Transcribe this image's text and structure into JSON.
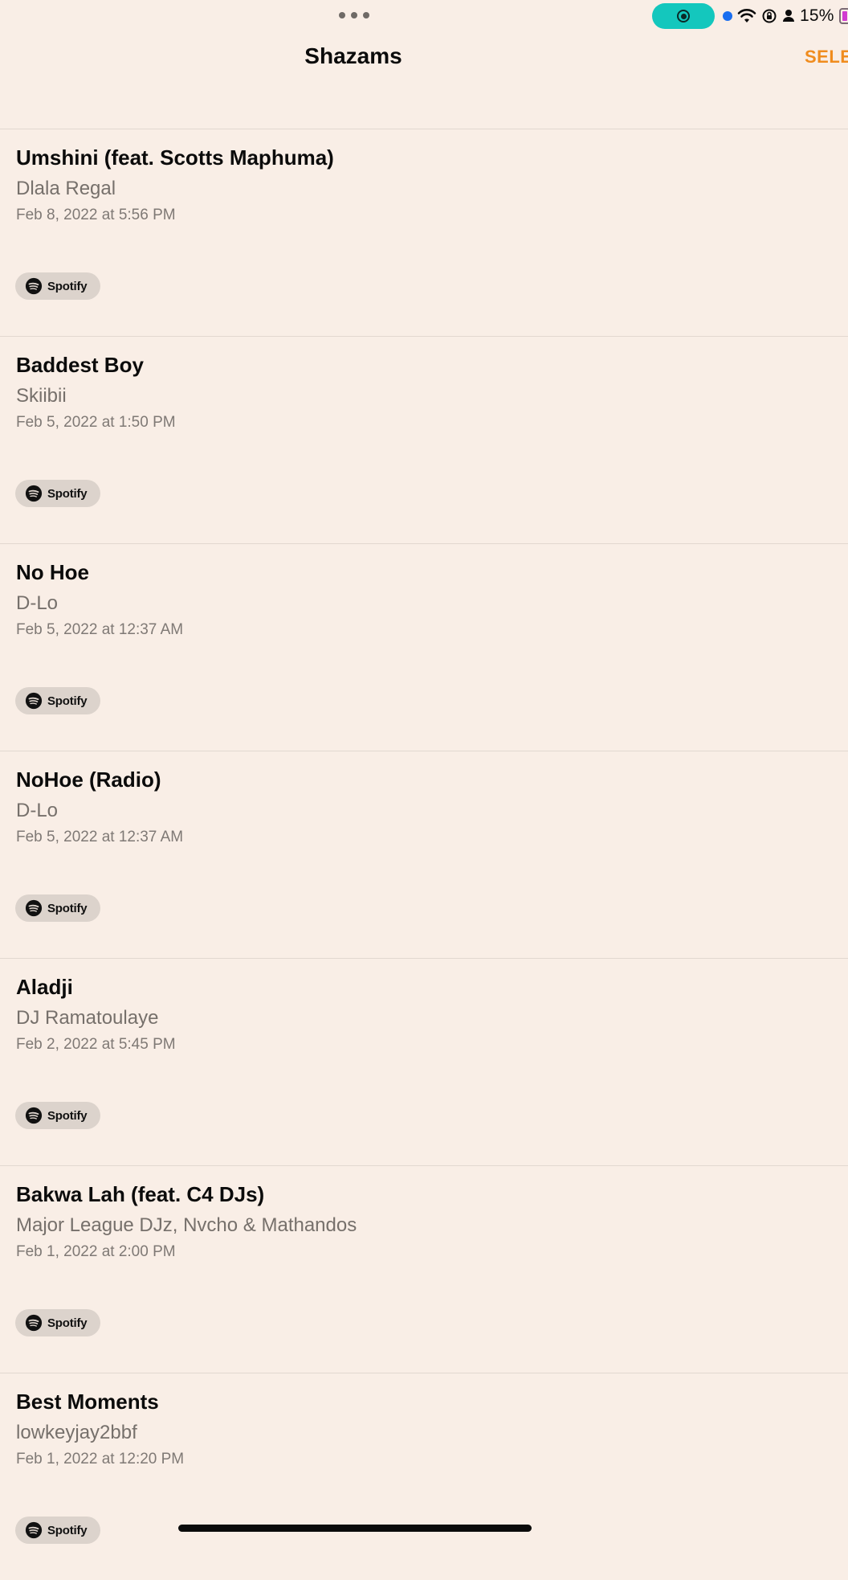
{
  "status_bar": {
    "battery_percent": "15%",
    "battery_level": 0.15,
    "icons": [
      "recording-icon",
      "location-dot-icon",
      "wifi-icon",
      "orientation-lock-icon",
      "person-icon",
      "battery-icon"
    ]
  },
  "nav": {
    "title": "Shazams",
    "select_label": "SELE",
    "accent_color": "#f08c1e"
  },
  "items": [
    {
      "title": "Umshini (feat. Scotts Maphuma)",
      "artist": "Dlala Regal",
      "date": "Feb 8, 2022 at 5:56 PM",
      "service": "Spotify"
    },
    {
      "title": "Baddest Boy",
      "artist": "Skiibii",
      "date": "Feb 5, 2022 at 1:50 PM",
      "service": "Spotify"
    },
    {
      "title": "No Hoe",
      "artist": "D-Lo",
      "date": "Feb 5, 2022 at 12:37 AM",
      "service": "Spotify"
    },
    {
      "title": "NoHoe (Radio)",
      "artist": "D-Lo",
      "date": "Feb 5, 2022 at 12:37 AM",
      "service": "Spotify"
    },
    {
      "title": "Aladji",
      "artist": "DJ Ramatoulaye",
      "date": "Feb 2, 2022 at 5:45 PM",
      "service": "Spotify"
    },
    {
      "title": "Bakwa Lah (feat. C4 DJs)",
      "artist": "Major League DJz, Nvcho & Mathandos",
      "date": "Feb 1, 2022 at 2:00 PM",
      "service": "Spotify"
    },
    {
      "title": "Best Moments",
      "artist": "lowkeyjay2bbf",
      "date": "Feb 1, 2022 at 12:20 PM",
      "service": "Spotify"
    }
  ]
}
